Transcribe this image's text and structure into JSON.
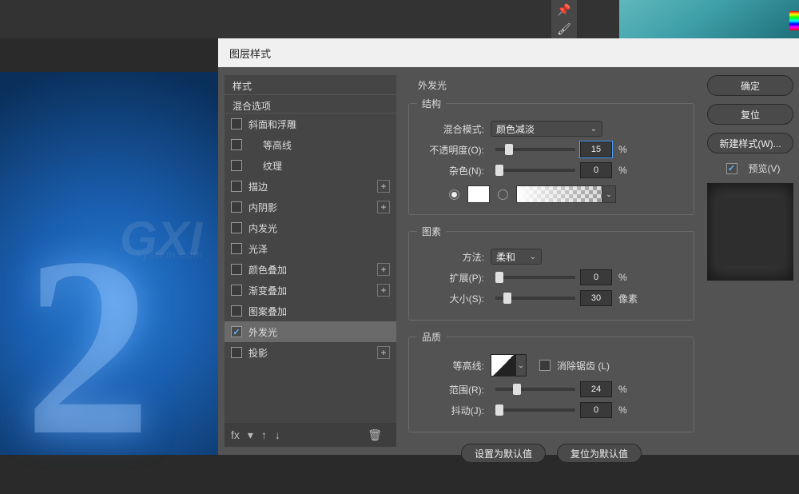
{
  "dialog": {
    "title": "图层样式"
  },
  "styles_panel": {
    "header_styles": "样式",
    "header_blend": "混合选项",
    "items": [
      {
        "label": "斜面和浮雕",
        "checked": false,
        "indent": false,
        "plus": false
      },
      {
        "label": "等高线",
        "checked": false,
        "indent": true,
        "plus": false
      },
      {
        "label": "纹理",
        "checked": false,
        "indent": true,
        "plus": false
      },
      {
        "label": "描边",
        "checked": false,
        "indent": false,
        "plus": true
      },
      {
        "label": "内阴影",
        "checked": false,
        "indent": false,
        "plus": true
      },
      {
        "label": "内发光",
        "checked": false,
        "indent": false,
        "plus": false
      },
      {
        "label": "光泽",
        "checked": false,
        "indent": false,
        "plus": false
      },
      {
        "label": "颜色叠加",
        "checked": false,
        "indent": false,
        "plus": true
      },
      {
        "label": "渐变叠加",
        "checked": false,
        "indent": false,
        "plus": true
      },
      {
        "label": "图案叠加",
        "checked": false,
        "indent": false,
        "plus": false
      },
      {
        "label": "外发光",
        "checked": true,
        "indent": false,
        "plus": false,
        "active": true
      },
      {
        "label": "投影",
        "checked": false,
        "indent": false,
        "plus": true
      }
    ],
    "fx_label": "fx"
  },
  "main": {
    "title": "外发光",
    "structure": {
      "legend": "结构",
      "blend_mode_label": "混合模式:",
      "blend_mode_value": "颜色减淡",
      "opacity_label": "不透明度(O):",
      "opacity_value": "15",
      "opacity_unit": "%",
      "noise_label": "杂色(N):",
      "noise_value": "0",
      "noise_unit": "%"
    },
    "elements": {
      "legend": "图素",
      "technique_label": "方法:",
      "technique_value": "柔和",
      "spread_label": "扩展(P):",
      "spread_value": "0",
      "spread_unit": "%",
      "size_label": "大小(S):",
      "size_value": "30",
      "size_unit": "像素"
    },
    "quality": {
      "legend": "品质",
      "contour_label": "等高线:",
      "antialias_label": "消除锯齿 (L)",
      "range_label": "范围(R):",
      "range_value": "24",
      "range_unit": "%",
      "jitter_label": "抖动(J):",
      "jitter_value": "0",
      "jitter_unit": "%"
    },
    "set_default": "设置为默认值",
    "reset_default": "复位为默认值"
  },
  "right": {
    "ok": "确定",
    "cancel": "复位",
    "new_style": "新建样式(W)...",
    "preview": "预览(V)"
  },
  "canvas": {
    "big_text": "2"
  }
}
